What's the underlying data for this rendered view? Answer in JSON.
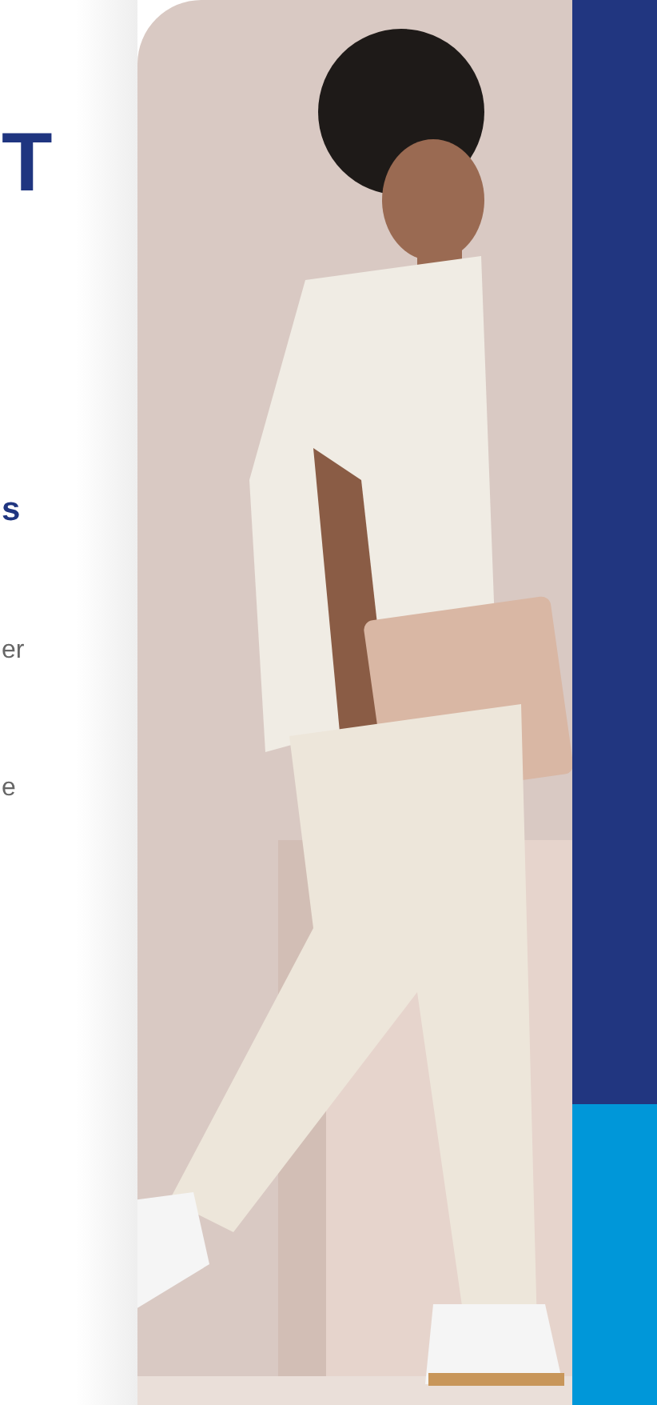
{
  "left_text": {
    "heading": "T",
    "subheading": "s",
    "body_lines": [
      "er",
      "e"
    ]
  }
}
